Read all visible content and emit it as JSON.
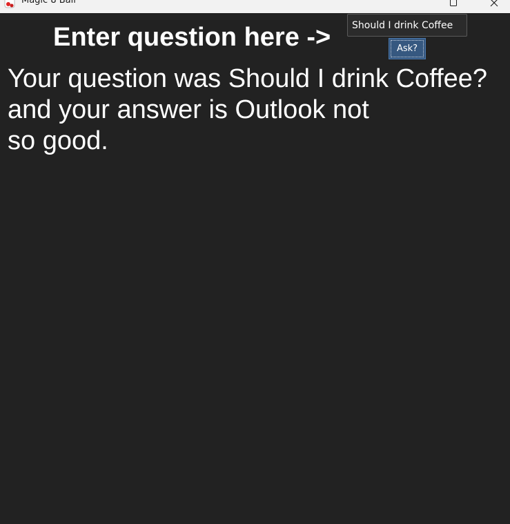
{
  "window": {
    "title": "Magic 8 Ball",
    "icon": "magic-8-ball-app-icon",
    "controls": [
      "maximize-icon",
      "close-icon"
    ]
  },
  "form": {
    "prompt_label": "Enter question here ->",
    "question_value": "Should I drink Coffee",
    "ask_button_label": "Ask?"
  },
  "result": {
    "lines": [
      "Your question was Should I drink Coffee?",
      "and your answer is Outlook not",
      "so good."
    ]
  },
  "colors": {
    "background": "#222222",
    "titlebar": "#f2f2f2",
    "text": "#ffffff",
    "button": "#365880"
  }
}
